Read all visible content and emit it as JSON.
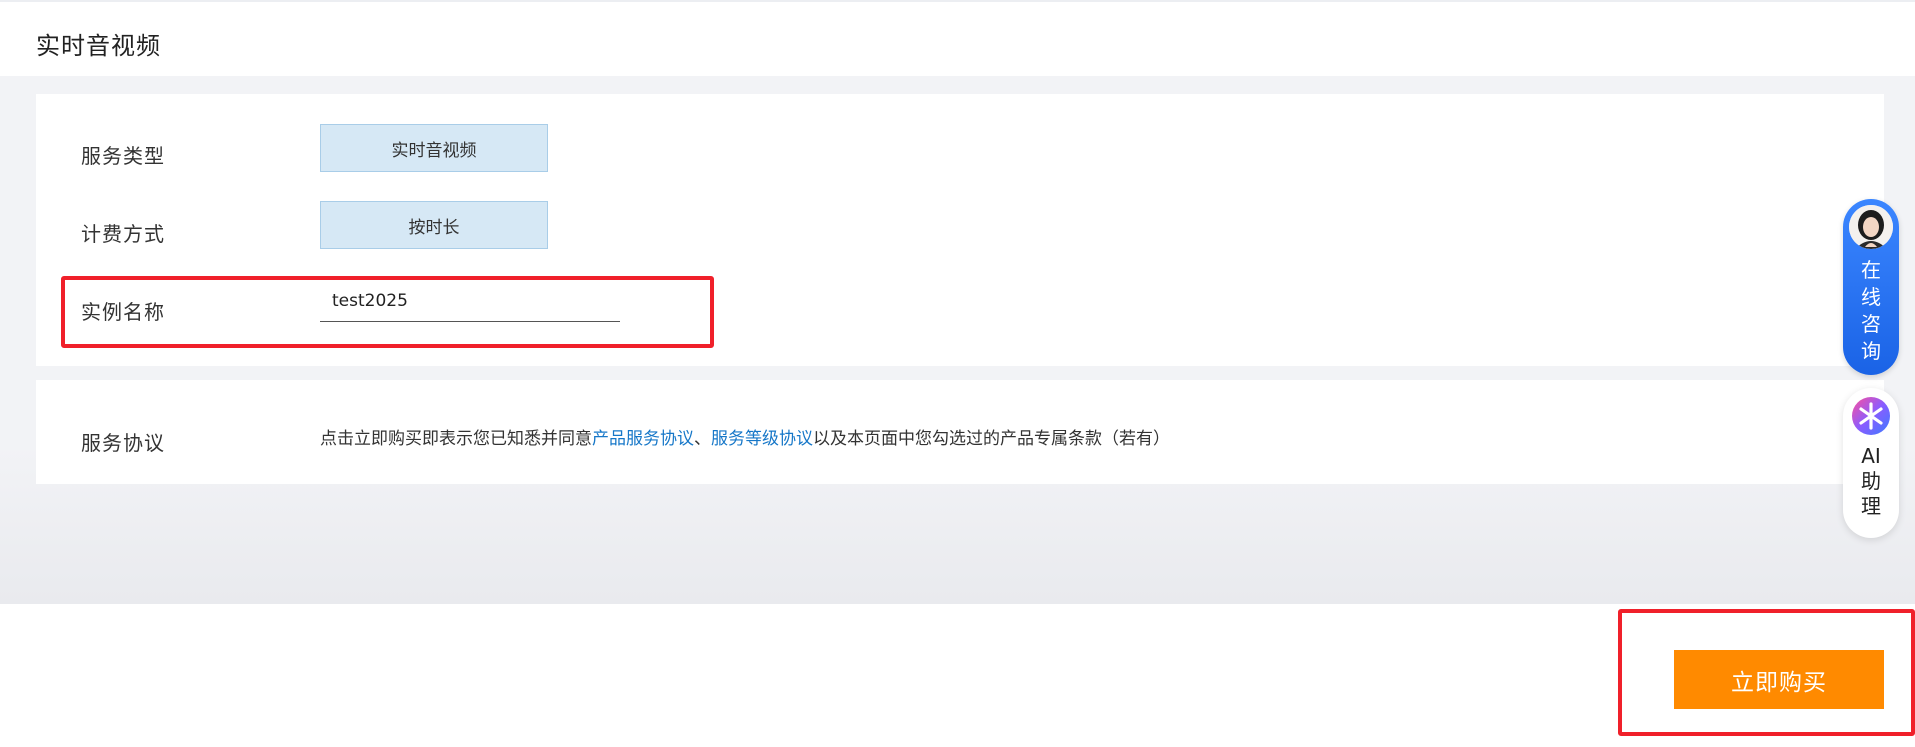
{
  "page": {
    "title": "实时音视频"
  },
  "form": {
    "service_type": {
      "label": "服务类型",
      "option": "实时音视频"
    },
    "billing": {
      "label": "计费方式",
      "option": "按时长"
    },
    "instance_name": {
      "label": "实例名称",
      "value": "test2025"
    }
  },
  "agreement": {
    "label": "服务协议",
    "prefix": "点击立即购买即表示您已知悉并同意",
    "link1": "产品服务协议",
    "separator": "、",
    "link2": "服务等级协议",
    "suffix": "以及本页面中您勾选过的产品专属条款（若有）"
  },
  "actions": {
    "buy_label": "立即购买"
  },
  "widgets": {
    "consult_lines": [
      "在",
      "线",
      "咨",
      "询"
    ],
    "ai_lines": [
      "AI",
      "助",
      "理"
    ]
  },
  "colors": {
    "accent_orange": "#ff8a00",
    "link_blue": "#1677c8",
    "highlight_red": "#f0202a",
    "option_bg": "#d6e8f5",
    "consult_blue": "#1a63e6"
  }
}
